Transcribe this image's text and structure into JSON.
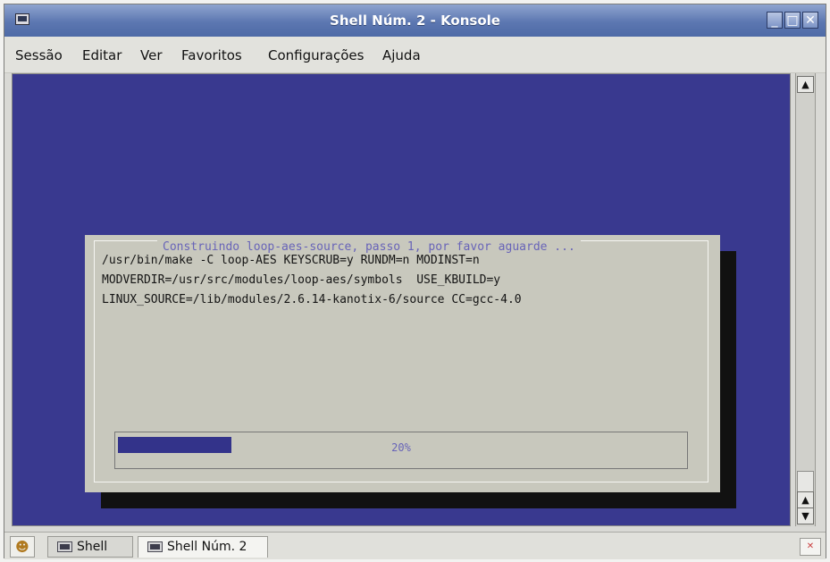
{
  "window": {
    "title": "Shell Núm. 2 - Konsole",
    "controls": {
      "minimize": "_",
      "maximize": "□",
      "close": "✕"
    }
  },
  "menu": {
    "items": [
      "Sessão",
      "Editar",
      "Ver",
      "Favoritos",
      "Configurações",
      "Ajuda"
    ]
  },
  "terminal": {
    "dialog": {
      "title": "Construindo loop-aes-source, passo 1, por favor aguarde ...",
      "lines": [
        "/usr/bin/make -C loop-AES KEYSCRUB=y RUNDM=n MODINST=n",
        "MODVERDIR=/usr/src/modules/loop-aes/symbols  USE_KBUILD=y",
        "LINUX_SOURCE=/lib/modules/2.6.14-kanotix-6/source CC=gcc-4.0"
      ],
      "progress_percent": 20,
      "progress_label": "20%"
    }
  },
  "tabs": {
    "new_tab_icon": "new-tab-icon",
    "items": [
      {
        "label": "Shell"
      },
      {
        "label": "Shell Núm. 2"
      }
    ],
    "close_icon": "close-tab-icon"
  },
  "colors": {
    "terminal_bg": "#39398f",
    "dialog_bg": "#c8c8bd",
    "title_bar": "#5c77b1"
  }
}
